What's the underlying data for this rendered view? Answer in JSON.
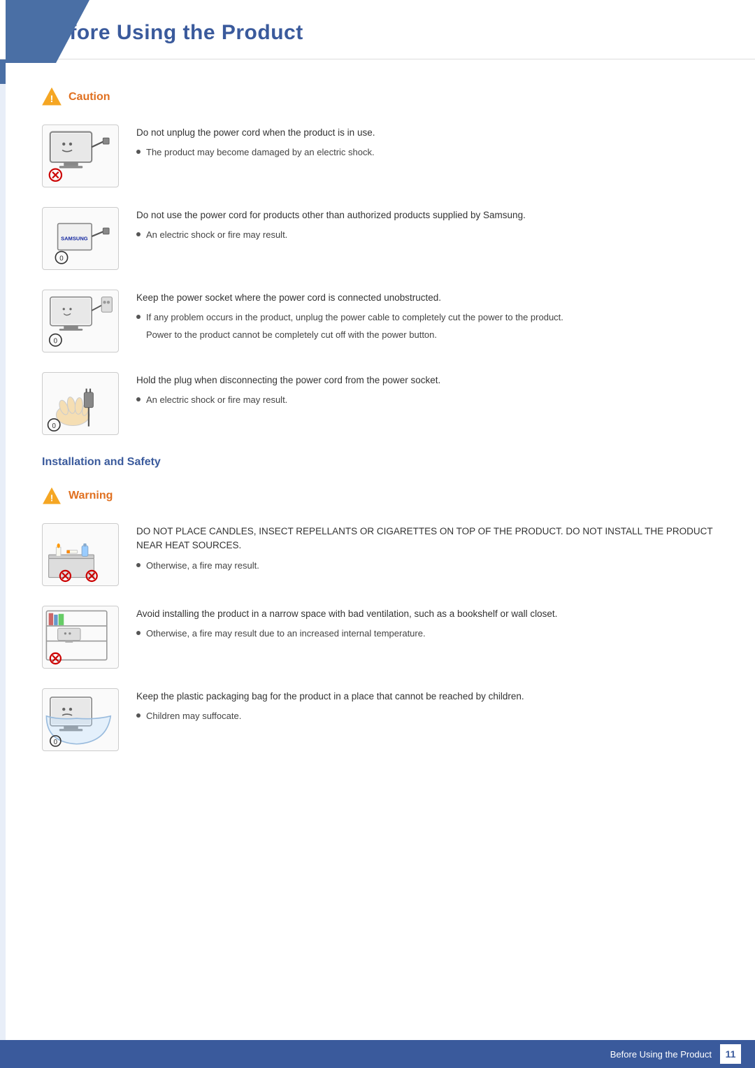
{
  "page": {
    "title": "Before Using the Product",
    "footer_text": "Before Using the Product",
    "page_number": "11"
  },
  "caution_section": {
    "label": "Caution",
    "items": [
      {
        "id": "item1",
        "main_text": "Do not unplug the power cord when the product is in use.",
        "sub_bullets": [
          "The product may become damaged by an electric shock."
        ],
        "extra_texts": []
      },
      {
        "id": "item2",
        "main_text": "Do not use the power cord for products other than authorized products supplied by Samsung.",
        "sub_bullets": [
          "An electric shock or fire may result."
        ],
        "extra_texts": []
      },
      {
        "id": "item3",
        "main_text": "Keep the power socket where the power cord is connected unobstructed.",
        "sub_bullets": [
          "If any problem occurs in the product, unplug the power cable to completely cut the power to the product."
        ],
        "extra_texts": [
          "Power to the product cannot be completely cut off with the power button."
        ]
      },
      {
        "id": "item4",
        "main_text": "Hold the plug when disconnecting the power cord from the power socket.",
        "sub_bullets": [
          "An electric shock or fire may result."
        ],
        "extra_texts": []
      }
    ]
  },
  "installation_section": {
    "title": "Installation and Safety",
    "warning_label": "Warning",
    "items": [
      {
        "id": "warn1",
        "main_text": "DO NOT PLACE CANDLES, INSECT REPELLANTS OR CIGARETTES ON TOP OF THE PRODUCT. DO NOT INSTALL THE PRODUCT NEAR HEAT SOURCES.",
        "sub_bullets": [
          "Otherwise, a fire may result."
        ],
        "extra_texts": []
      },
      {
        "id": "warn2",
        "main_text": "Avoid installing the product in a narrow space with bad ventilation, such as a bookshelf or wall closet.",
        "sub_bullets": [
          "Otherwise, a fire may result due to an increased internal temperature."
        ],
        "extra_texts": []
      },
      {
        "id": "warn3",
        "main_text": "Keep the plastic packaging bag for the product in a place that cannot be reached by children.",
        "sub_bullets": [
          "Children may suffocate."
        ],
        "extra_texts": []
      }
    ]
  }
}
